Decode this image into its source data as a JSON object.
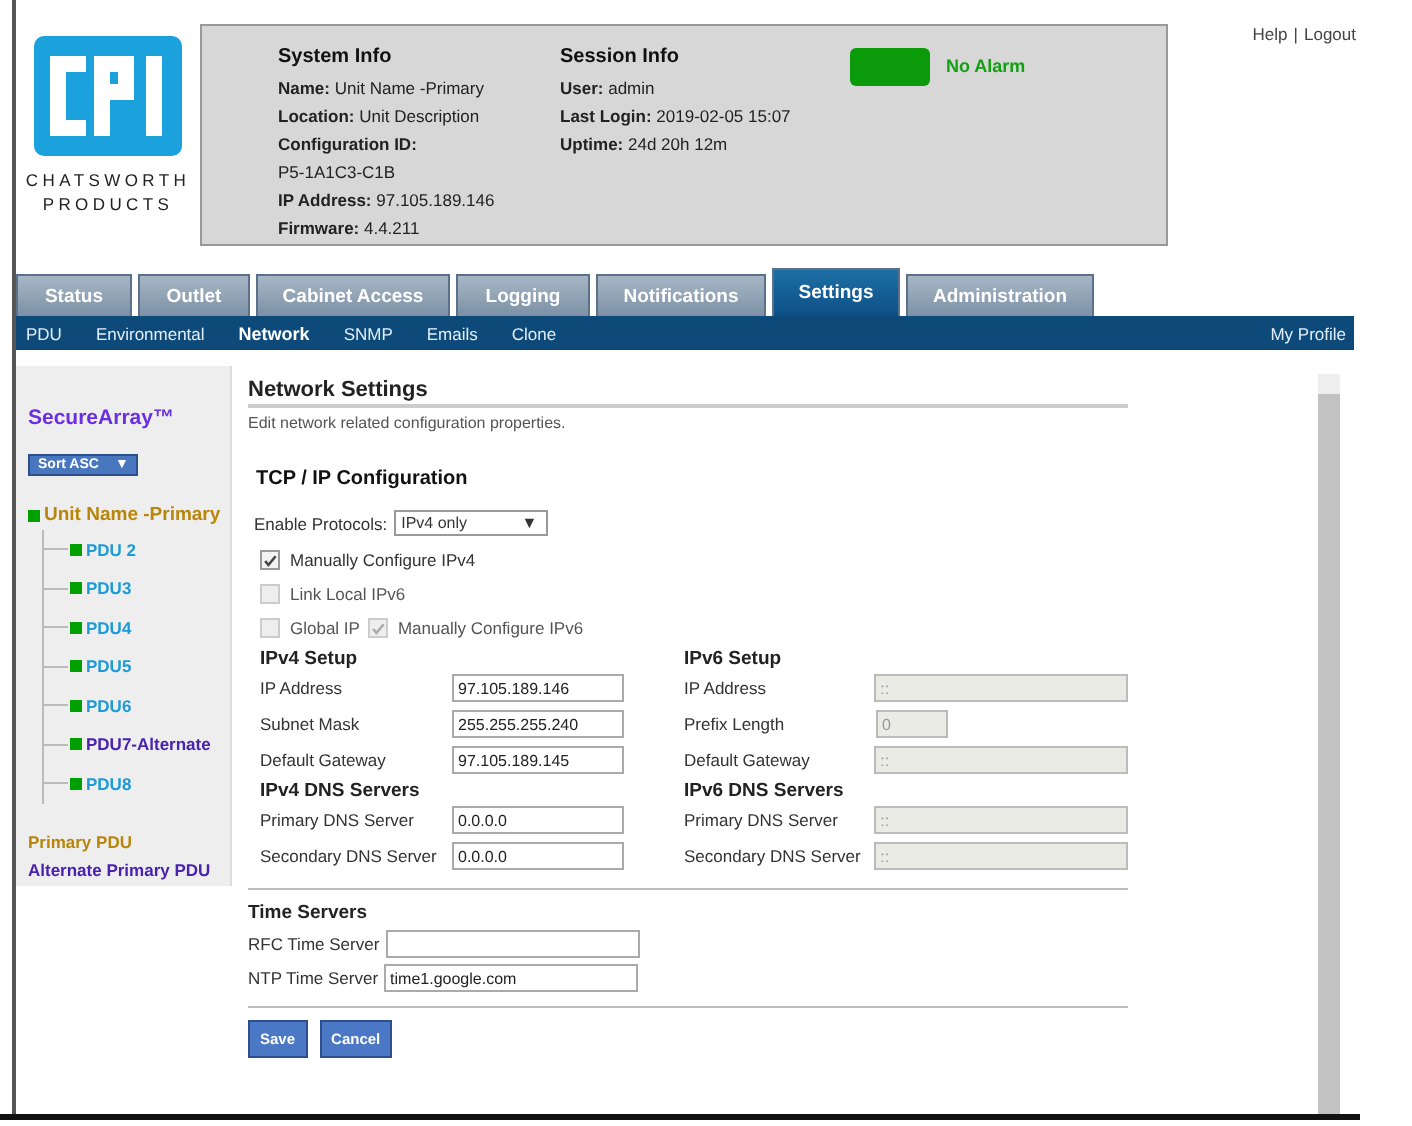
{
  "header": {
    "brand": [
      "CHATSWORTH",
      "PRODUCTS"
    ],
    "help": "Help",
    "logout": "Logout",
    "separator": "|",
    "system_info": {
      "title": "System Info",
      "fields": [
        {
          "label": "Name:",
          "value": "Unit Name -Primary"
        },
        {
          "label": "Location:",
          "value": "Unit Description"
        },
        {
          "label": "Configuration ID:"
        },
        {
          "value": "P5-1A1C3-C1B"
        },
        {
          "label": "IP Address:",
          "value": "97.105.189.146"
        },
        {
          "label": "Firmware:",
          "value": "4.4.211"
        }
      ]
    },
    "session_info": {
      "title": "Session Info",
      "fields": [
        {
          "label": "User:",
          "value": "admin"
        },
        {
          "label": "Last Login:",
          "value": "2019-02-05 15:07"
        },
        {
          "label": "Uptime:",
          "value": "24d 20h 12m"
        }
      ]
    },
    "alarm": {
      "label": "No Alarm",
      "active": false
    }
  },
  "tabs": [
    {
      "label": "Status",
      "selected": false
    },
    {
      "label": "Outlet",
      "selected": false
    },
    {
      "label": "Cabinet Access",
      "selected": false
    },
    {
      "label": "Logging",
      "selected": false
    },
    {
      "label": "Notifications",
      "selected": false
    },
    {
      "label": "Settings",
      "selected": true
    },
    {
      "label": "Administration",
      "selected": false
    }
  ],
  "subnav": {
    "items": [
      {
        "label": "PDU",
        "selected": false
      },
      {
        "label": "Environmental",
        "selected": false
      },
      {
        "label": "Network",
        "selected": true
      },
      {
        "label": "SNMP",
        "selected": false
      },
      {
        "label": "Emails",
        "selected": false
      },
      {
        "label": "Clone",
        "selected": false
      }
    ],
    "profile": "My Profile"
  },
  "sidebar": {
    "title": "SecureArray™",
    "sort": "Sort ASC",
    "sort_arrow": "▼",
    "tree": [
      {
        "label": "Unit Name -Primary",
        "kind": "primary",
        "color": "#00a000",
        "children": [
          {
            "label": "PDU 2",
            "kind": "member",
            "color": "#00a000"
          },
          {
            "label": "PDU3",
            "kind": "member",
            "color": "#00a000"
          },
          {
            "label": "PDU4",
            "kind": "member",
            "color": "#00a000"
          },
          {
            "label": "PDU5",
            "kind": "member",
            "color": "#00a000"
          },
          {
            "label": "PDU6",
            "kind": "member",
            "color": "#00a000"
          },
          {
            "label": "PDU7-Alternate",
            "kind": "alternate",
            "color": "#00a000"
          },
          {
            "label": "PDU8",
            "kind": "member",
            "color": "#00a000"
          }
        ]
      }
    ],
    "legend": [
      {
        "label": "Primary PDU",
        "kind": "primary"
      },
      {
        "label": "Alternate Primary PDU",
        "kind": "alternate"
      }
    ]
  },
  "content": {
    "title": "Network Settings",
    "description": "Edit network related configuration properties.",
    "tcp_title": "TCP / IP Configuration",
    "protocols": {
      "label": "Enable Protocols:",
      "value": "IPv4 only",
      "arrow": "▼"
    },
    "checkbox_rows": [
      [
        {
          "label": "Manually Configure IPv4",
          "checked": true,
          "disabled": false
        }
      ],
      [
        {
          "label": "Link Local IPv6",
          "checked": false,
          "disabled": true
        }
      ],
      [
        {
          "label": "Global IP",
          "checked": false,
          "disabled": true
        },
        {
          "label": "Manually Configure IPv6",
          "checked": true,
          "disabled": true
        }
      ]
    ],
    "columns": [
      {
        "sections": [
          {
            "title": "IPv4 Setup",
            "fields": [
              {
                "label": "IP Address",
                "value": "97.105.189.146",
                "disabled": false,
                "kind": "wide"
              },
              {
                "label": "Subnet Mask",
                "value": "255.255.255.240",
                "disabled": false,
                "kind": "wide"
              },
              {
                "label": "Default Gateway",
                "value": "97.105.189.145",
                "disabled": false,
                "kind": "wide"
              }
            ]
          },
          {
            "title": "IPv4 DNS Servers",
            "fields": [
              {
                "label": "Primary DNS Server",
                "value": "0.0.0.0",
                "disabled": false,
                "kind": "wide"
              },
              {
                "label": "Secondary DNS Server",
                "value": "0.0.0.0",
                "disabled": false,
                "kind": "wide"
              }
            ]
          }
        ]
      },
      {
        "sections": [
          {
            "title": "IPv6 Setup",
            "fields": [
              {
                "label": "IP Address",
                "value": "::",
                "disabled": true,
                "kind": "wide"
              },
              {
                "label": "Prefix Length",
                "value": "0",
                "disabled": true,
                "kind": "short"
              },
              {
                "label": "Default Gateway",
                "value": "::",
                "disabled": true,
                "kind": "wide"
              }
            ]
          },
          {
            "title": "IPv6 DNS Servers",
            "fields": [
              {
                "label": "Primary DNS Server",
                "value": "::",
                "disabled": true,
                "kind": "wide"
              },
              {
                "label": "Secondary DNS Server",
                "value": "::",
                "disabled": true,
                "kind": "wide"
              }
            ]
          }
        ]
      }
    ],
    "time": {
      "title": "Time Servers",
      "fields": [
        {
          "label": "RFC Time Server"
        },
        {
          "label": "NTP Time Server",
          "value": "time1.google.com"
        }
      ]
    },
    "buttons": [
      "Save",
      "Cancel"
    ]
  }
}
